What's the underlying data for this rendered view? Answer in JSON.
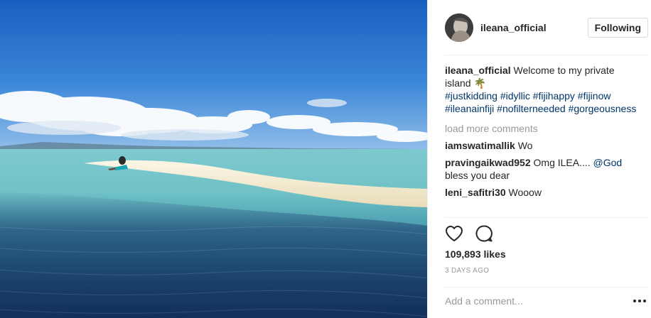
{
  "post": {
    "author": "ileana_official",
    "follow_label": "Following",
    "caption": {
      "user": "ileana_official",
      "text": "Welcome to my private island",
      "emoji": "🌴",
      "hashtags": [
        "#justkidding",
        "#idyllic",
        "#fijihappy",
        "#fijinow",
        "#ileanainfiji",
        "#nofilterneeded",
        "#gorgeousness"
      ]
    },
    "load_more_label": "load more comments",
    "comments": [
      {
        "user": "iamswatimallik",
        "text": "Wo"
      },
      {
        "user": "pravingaikwad952",
        "text": "Omg ILEA....",
        "mention": "@God",
        "text_after": "bless you dear"
      },
      {
        "user": "leni_safitri30",
        "text": "Wooow"
      }
    ],
    "likes": "109,893 likes",
    "time": "3 DAYS AGO",
    "add_comment_placeholder": "Add a comment...",
    "icons": {
      "like": "heart-icon",
      "comment": "comment-bubble-icon",
      "more": "more-options-icon"
    },
    "colors": {
      "link": "#003569",
      "muted": "#999999",
      "text": "#262626",
      "border": "#efefef"
    }
  }
}
